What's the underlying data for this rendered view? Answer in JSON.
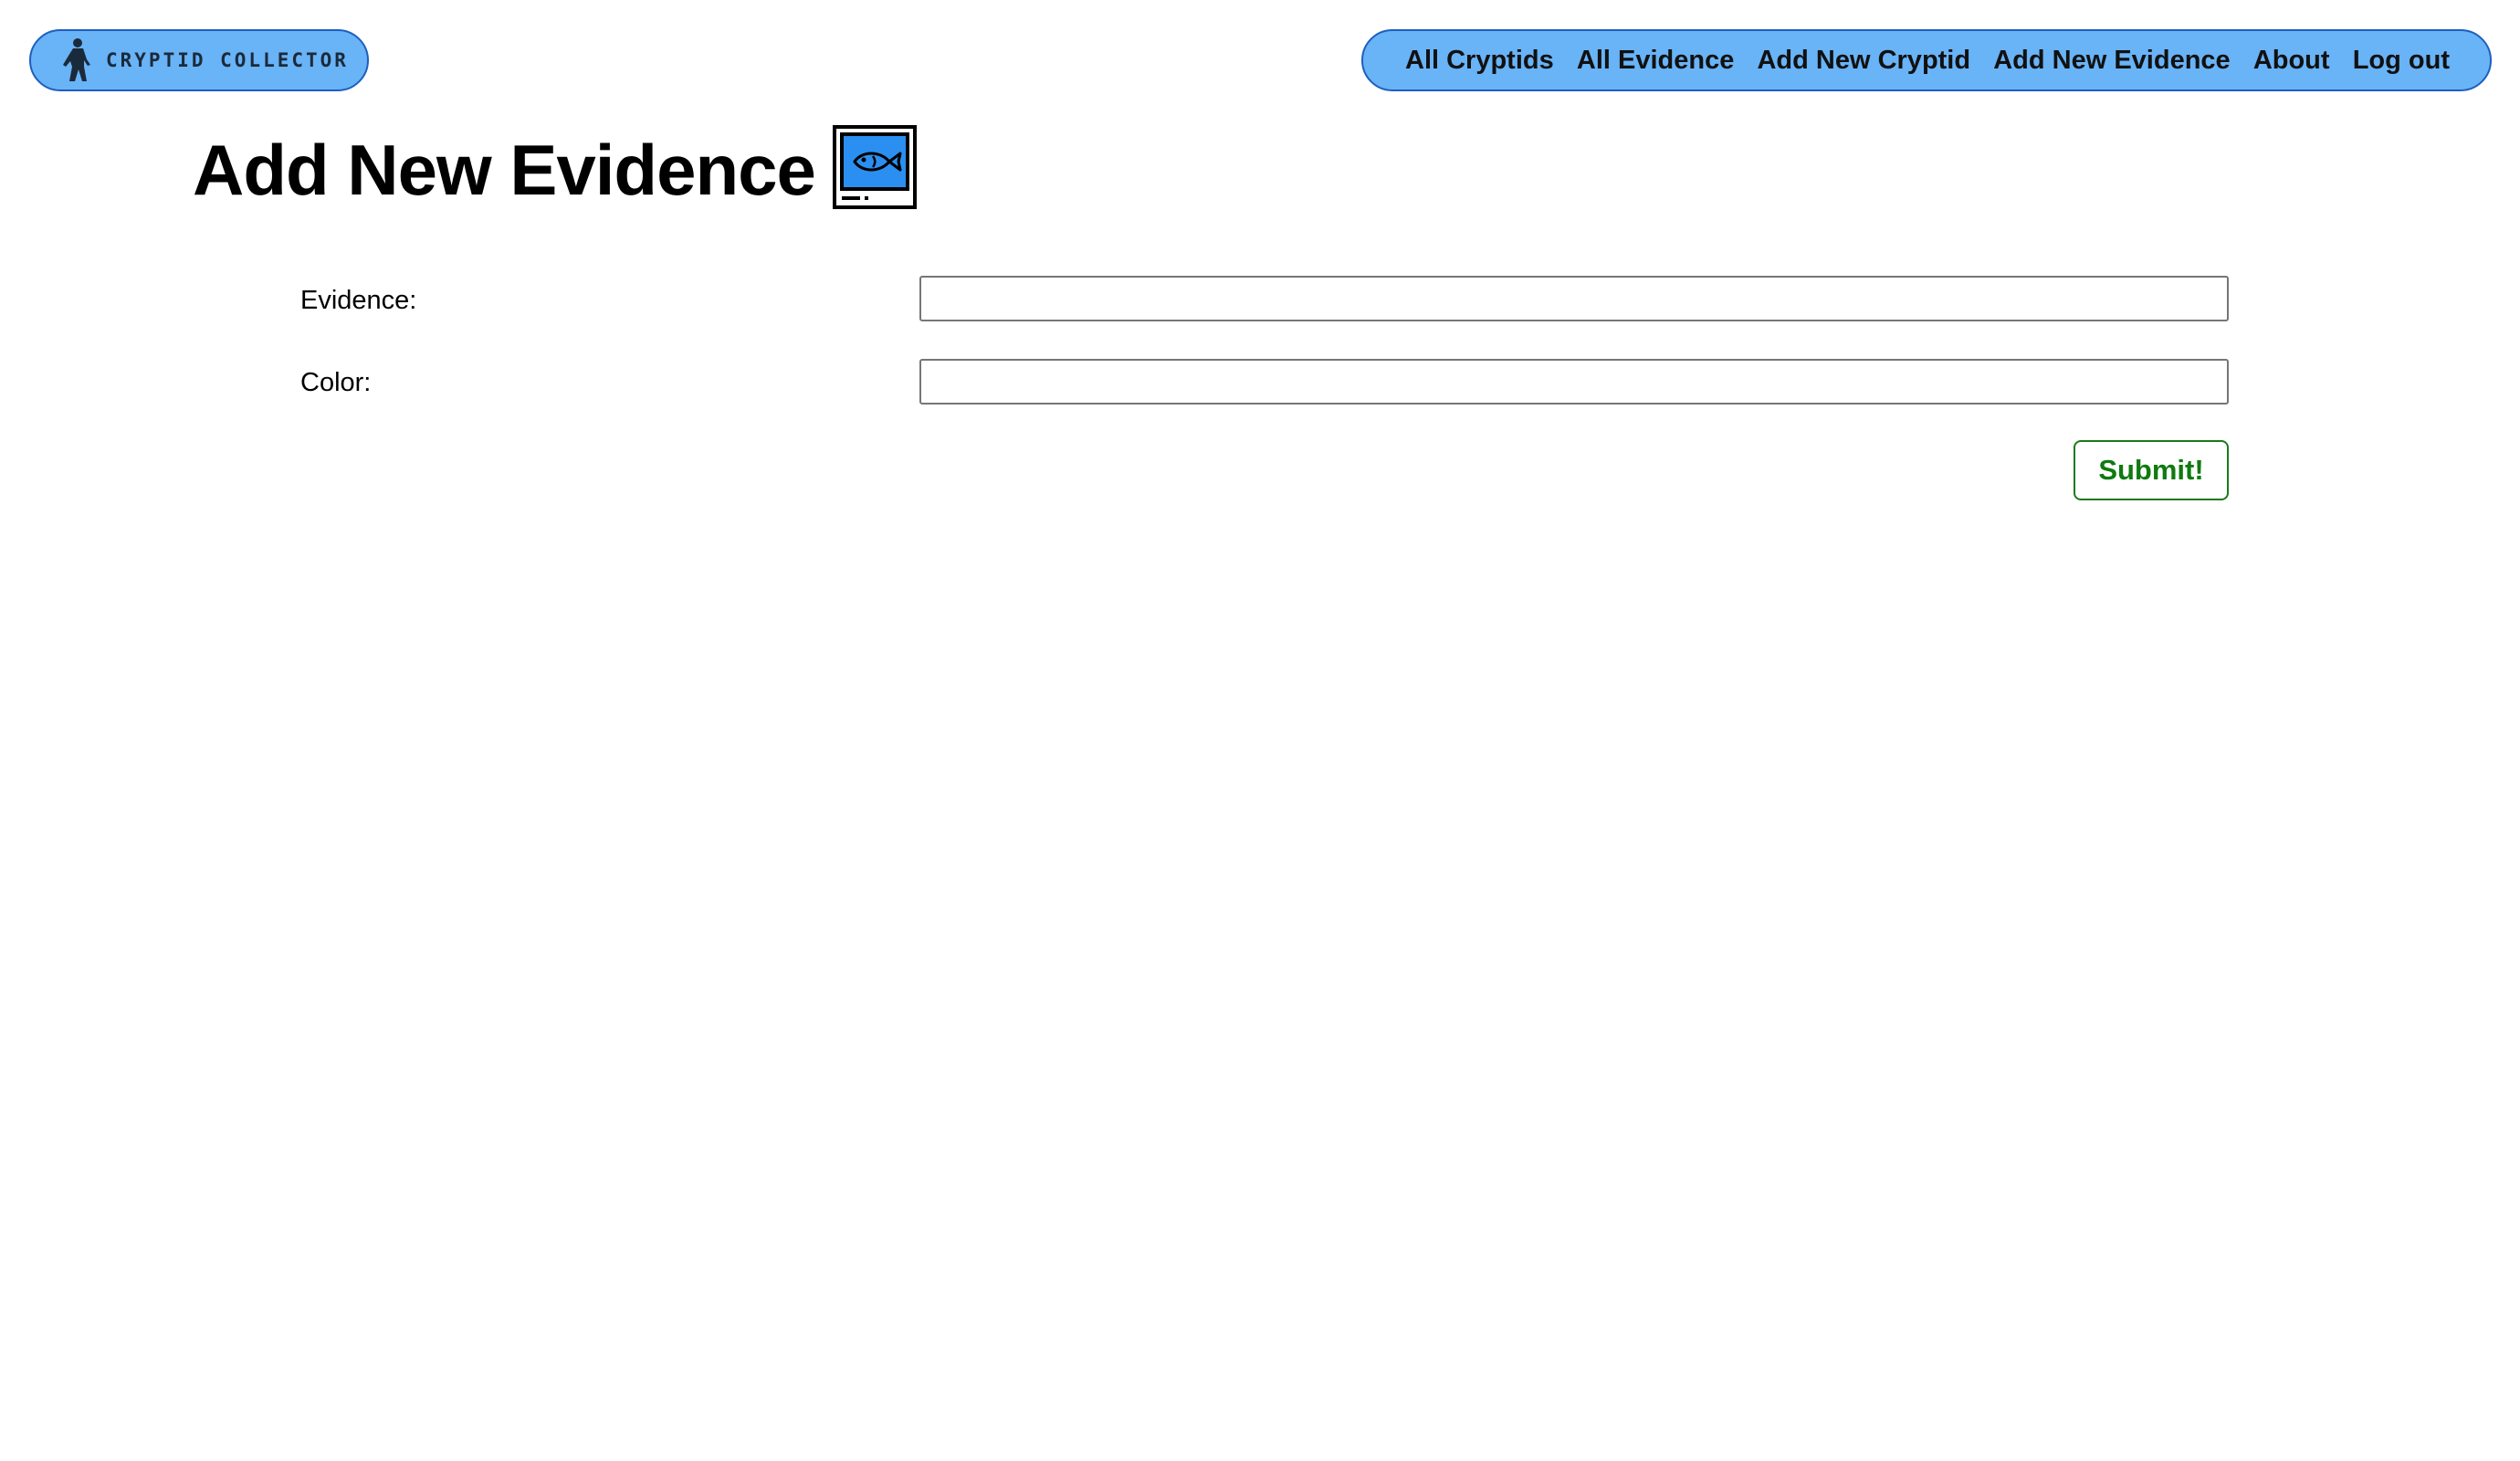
{
  "header": {
    "logo": {
      "text": "CRYPTID COLLECTOR",
      "icon": "bigfoot-icon"
    },
    "nav": [
      {
        "label": "All Cryptids"
      },
      {
        "label": "All Evidence"
      },
      {
        "label": "Add New Cryptid"
      },
      {
        "label": "Add New Evidence"
      },
      {
        "label": "About"
      },
      {
        "label": "Log out"
      }
    ],
    "accent_color": "#69b3f7",
    "border_color": "#1e5fbf"
  },
  "main": {
    "title": "Add New Evidence",
    "title_icon": "fish-monitor-icon",
    "form": {
      "evidence_label": "Evidence:",
      "evidence_value": "",
      "color_label": "Color:",
      "color_value": "",
      "submit_label": "Submit!",
      "submit_color": "#0f7a0f"
    }
  }
}
